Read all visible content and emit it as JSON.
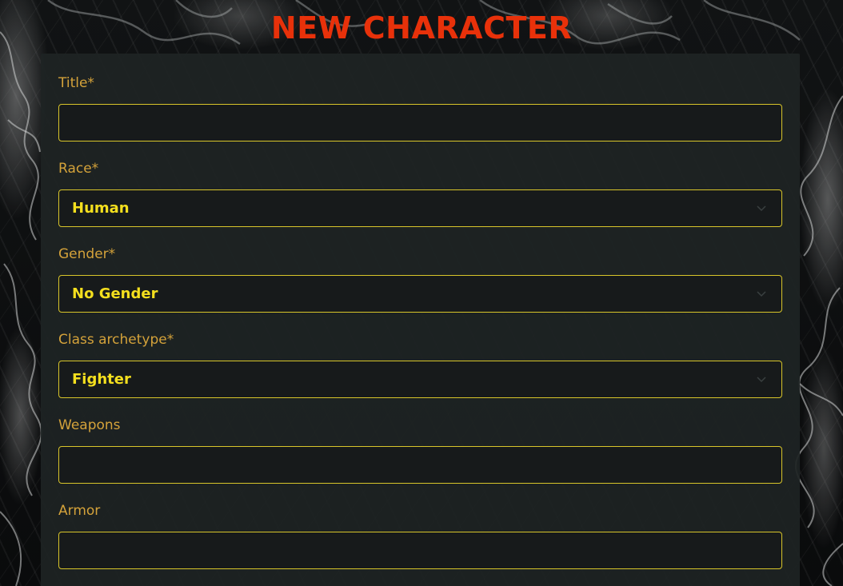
{
  "page": {
    "title": "NEW CHARACTER"
  },
  "form": {
    "title_field": {
      "label": "Title*",
      "value": "",
      "placeholder": ""
    },
    "race_field": {
      "label": "Race*",
      "selected": "Human",
      "icon": "chevron-down-icon"
    },
    "gender_field": {
      "label": "Gender*",
      "selected": "No Gender",
      "icon": "chevron-down-icon"
    },
    "class_field": {
      "label": "Class archetype*",
      "selected": "Fighter",
      "icon": "chevron-down-icon"
    },
    "weapons_field": {
      "label": "Weapons",
      "value": "",
      "placeholder": ""
    },
    "armor_field": {
      "label": "Armor",
      "value": "",
      "placeholder": ""
    }
  },
  "colors": {
    "title": "#e8310a",
    "label": "#d4a23a",
    "field_border": "#d8c52a",
    "select_text": "#f4df1e",
    "panel": "#1e2323"
  }
}
